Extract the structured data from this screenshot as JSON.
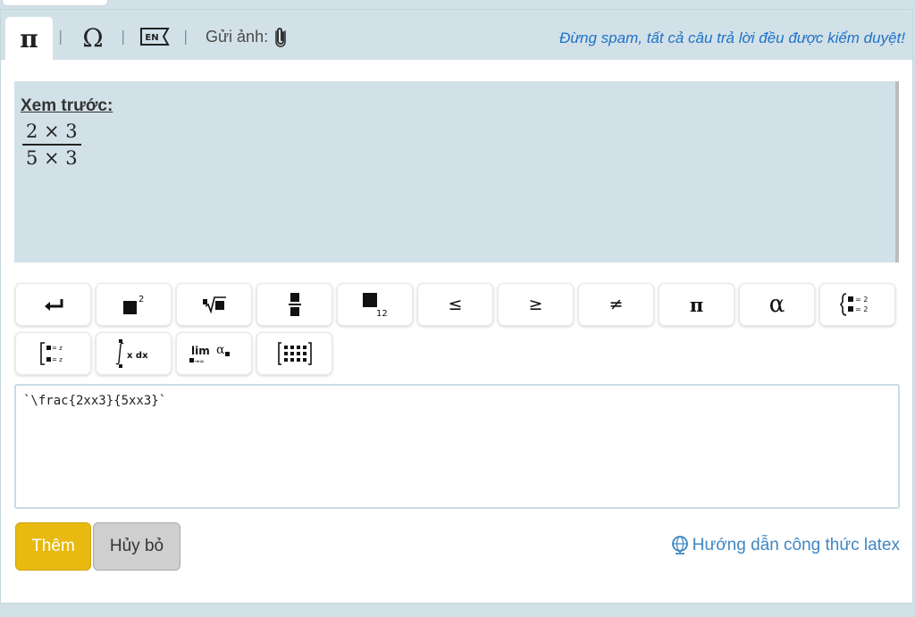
{
  "tabs": {
    "symbols": [
      {
        "name": "pi",
        "glyph": "π"
      },
      {
        "name": "omega",
        "glyph": "Ω"
      },
      {
        "name": "language",
        "glyph": "EN"
      }
    ],
    "separator": "|",
    "upload_label": "Gửi ảnh:"
  },
  "notice": "Đừng spam, tất cả câu trả lời đều được kiểm duyệt!",
  "preview": {
    "title": "Xem trước:",
    "numerator": "2 × 3",
    "denominator": "5 × 3"
  },
  "toolbar": {
    "leq": "≤",
    "geq": "≥",
    "neq": "≠",
    "pi": "π",
    "alpha": "α",
    "superscript_sample": "2",
    "subscript_sample": "12",
    "system_eq": "= 2",
    "system_alt": "= z",
    "integral_label": "x dx",
    "limit_label": "lim",
    "limit_sub": "→∞",
    "limit_var": "α"
  },
  "editor": {
    "value": "`\\frac{2xx3}{5xx3}`"
  },
  "actions": {
    "add_label": "Thêm",
    "cancel_label": "Hủy bỏ",
    "guide_label": "Hướng dẫn công thức latex"
  },
  "colors": {
    "panel_bg": "#d2e1e8",
    "notice": "#1e72c7",
    "add_button": "#e8b90f",
    "cancel_button": "#cfcfcf",
    "guide_link": "#3f86c2"
  },
  "icons": {
    "upload": "paperclip-icon",
    "guide": "globe-icon",
    "enter": "enter-arrow-icon"
  }
}
